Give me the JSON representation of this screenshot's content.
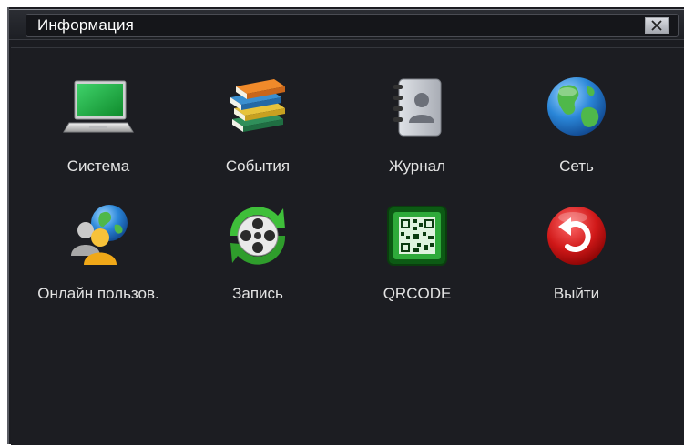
{
  "window": {
    "title": "Информация"
  },
  "menu": {
    "items": [
      {
        "label": "Система",
        "icon": "laptop-icon"
      },
      {
        "label": "События",
        "icon": "books-icon"
      },
      {
        "label": "Журнал",
        "icon": "contacts-book-icon"
      },
      {
        "label": "Сеть",
        "icon": "globe-icon"
      },
      {
        "label": "Онлайн пользов.",
        "icon": "online-users-icon"
      },
      {
        "label": "Запись",
        "icon": "film-reel-icon"
      },
      {
        "label": "QRCODE",
        "icon": "qrcode-icon"
      },
      {
        "label": "Выйти",
        "icon": "exit-icon"
      }
    ]
  },
  "colors": {
    "background": "#1c1d22",
    "label_text": "#e4e4e4",
    "title_text": "#ffffff"
  }
}
